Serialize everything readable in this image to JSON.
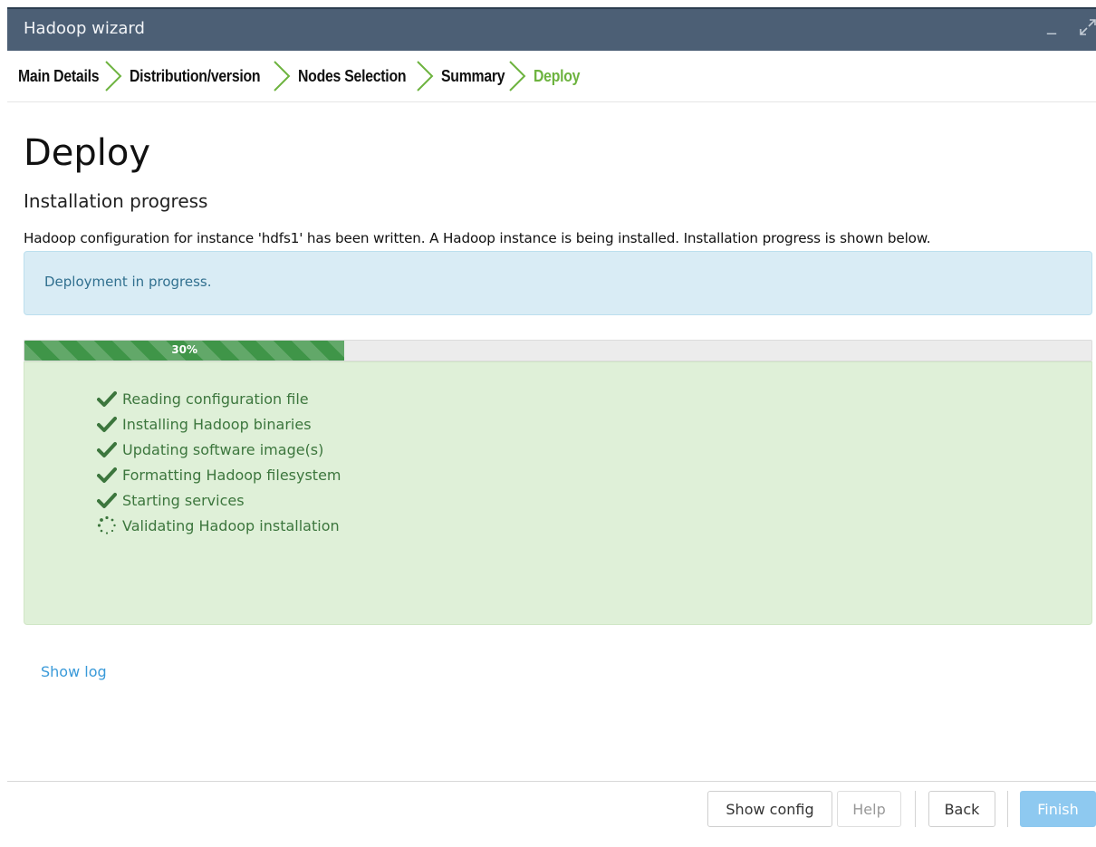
{
  "window": {
    "title": "Hadoop wizard"
  },
  "steps": [
    {
      "label": "Main Details",
      "active": false
    },
    {
      "label": "Distribution/version",
      "active": false
    },
    {
      "label": "Nodes Selection",
      "active": false
    },
    {
      "label": "Summary",
      "active": false
    },
    {
      "label": "Deploy",
      "active": true
    }
  ],
  "page": {
    "heading": "Deploy",
    "subheading": "Installation progress",
    "description": "Hadoop configuration for instance 'hdfs1' has been written. A Hadoop instance is being installed. Installation progress is shown below."
  },
  "alert": {
    "text": "Deployment in progress."
  },
  "progress": {
    "label": "30%",
    "percent": 30
  },
  "tasks": [
    {
      "label": "Reading configuration file",
      "status": "done",
      "icon": "check-icon"
    },
    {
      "label": "Installing Hadoop binaries",
      "status": "done",
      "icon": "check-icon"
    },
    {
      "label": "Updating software image(s)",
      "status": "done",
      "icon": "check-icon"
    },
    {
      "label": "Formatting Hadoop filesystem",
      "status": "done",
      "icon": "check-icon"
    },
    {
      "label": "Starting services",
      "status": "done",
      "icon": "check-icon"
    },
    {
      "label": "Validating Hadoop installation",
      "status": "in-progress",
      "icon": "spinner-icon"
    }
  ],
  "links": {
    "show_log": "Show log"
  },
  "buttons": {
    "show_config": "Show config",
    "help": "Help",
    "back": "Back",
    "finish": "Finish"
  },
  "colors": {
    "titlebar": "#4c5f75",
    "step_active": "#6db33f",
    "progress_fill": "#3f9548",
    "success_text": "#3c763d",
    "info_text": "#31708f",
    "link": "#3a9ad9",
    "primary_button": "#8ec9f0"
  }
}
